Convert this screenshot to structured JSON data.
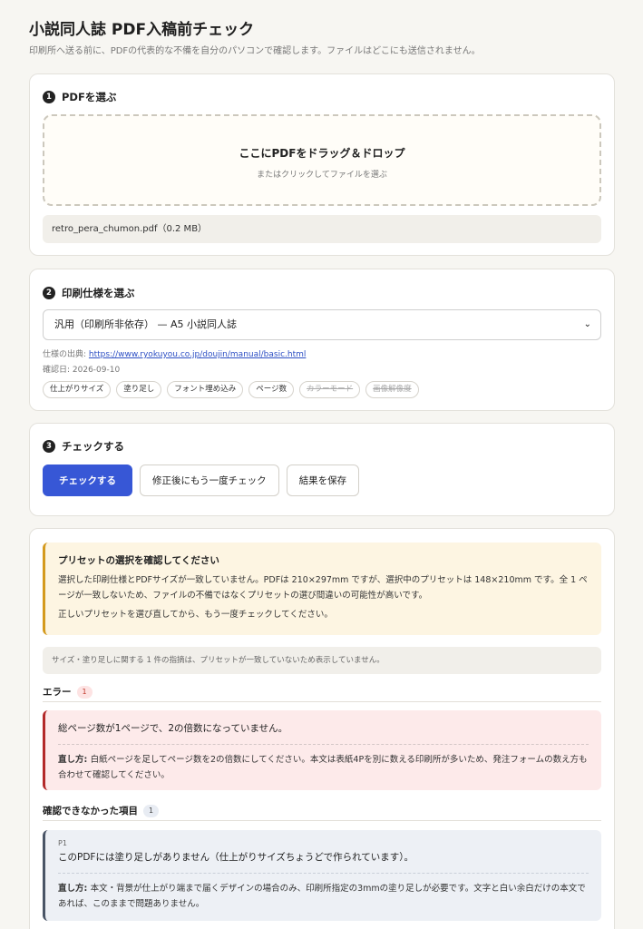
{
  "header": {
    "title": "小説同人誌 PDF入稿前チェック",
    "subtitle": "印刷所へ送る前に、PDFの代表的な不備を自分のパソコンで確認します。ファイルはどこにも送信されません。"
  },
  "step1": {
    "num": "1",
    "title": "PDFを選ぶ",
    "dropzone_title": "ここにPDFをドラッグ＆ドロップ",
    "dropzone_sub": "またはクリックしてファイルを選ぶ",
    "file_info": "retro_pera_chumon.pdf（0.2 MB）"
  },
  "step2": {
    "num": "2",
    "title": "印刷仕様を選ぶ",
    "selected": "汎用（印刷所非依存） — A5 小説同人誌",
    "source_label": "仕様の出典: ",
    "source_url": "https://www.ryokuyou.co.jp/doujin/manual/basic.html",
    "checked_date": "確認日: 2026-09-10",
    "tags": [
      {
        "label": "仕上がりサイズ",
        "enabled": true
      },
      {
        "label": "塗り足し",
        "enabled": true
      },
      {
        "label": "フォント埋め込み",
        "enabled": true
      },
      {
        "label": "ページ数",
        "enabled": true
      },
      {
        "label": "カラーモード",
        "enabled": false
      },
      {
        "label": "画像解像度",
        "enabled": false
      }
    ]
  },
  "step3": {
    "num": "3",
    "title": "チェックする",
    "check_button": "チェックする",
    "recheck_button": "修正後にもう一度チェック",
    "save_button": "結果を保存"
  },
  "results": {
    "warning_title": "プリセットの選択を確認してください",
    "warning_p1": "選択した印刷仕様とPDFサイズが一致していません。PDFは 210×297mm ですが、選択中のプリセットは 148×210mm です。全 1 ページが一致しないため、ファイルの不備ではなくプリセットの選び間違いの可能性が高いです。",
    "warning_p2": "正しいプリセットを選び直してから、もう一度チェックしてください。",
    "hidden_note": "サイズ・塗り足しに関する 1 件の指摘は、プリセットが一致していないため表示していません。",
    "errors_label": "エラー",
    "errors_count": "1",
    "error_title": "総ページ数が1ページで、2の倍数になっていません。",
    "fix_label": "直し方: ",
    "error_fix": "白紙ページを足してページ数を2の倍数にしてください。本文は表紙4Pを別に数える印刷所が多いため、発注フォームの数え方も合わせて確認してください。",
    "unknown_label": "確認できなかった項目",
    "unknown_count": "1",
    "unknown_page": "P1",
    "unknown_title": "このPDFには塗り足しがありません（仕上がりサイズちょうどで作られています）。",
    "unknown_fix": "本文・背景が仕上がり端まで届くデザインの場合のみ、印刷所指定の3mmの塗り足しが必要です。文字と白い余白だけの本文であれば、このままで問題ありません。"
  }
}
